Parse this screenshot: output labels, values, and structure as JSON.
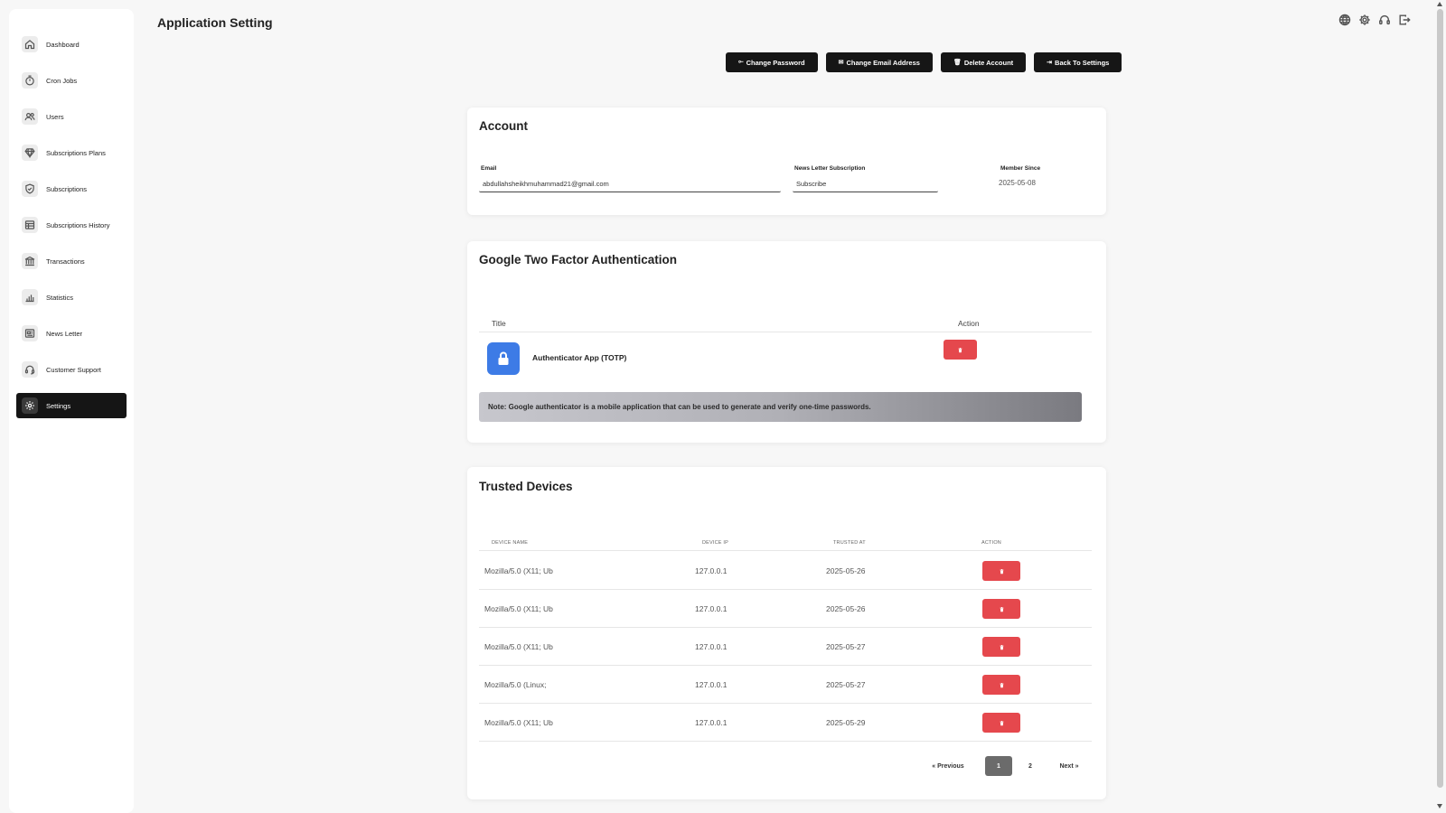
{
  "page": {
    "title": "Application Setting"
  },
  "sidebar": {
    "items": [
      {
        "label": "Dashboard",
        "icon": "home-icon",
        "active": false
      },
      {
        "label": "Cron Jobs",
        "icon": "timer-icon",
        "active": false
      },
      {
        "label": "Users",
        "icon": "users-icon",
        "active": false
      },
      {
        "label": "Subscriptions Plans",
        "icon": "diamond-icon",
        "active": false
      },
      {
        "label": "Subscriptions",
        "icon": "shield-icon",
        "active": false
      },
      {
        "label": "Subscriptions History",
        "icon": "table-icon",
        "active": false
      },
      {
        "label": "Transactions",
        "icon": "bank-icon",
        "active": false
      },
      {
        "label": "Statistics",
        "icon": "bar-chart-icon",
        "active": false
      },
      {
        "label": "News Letter",
        "icon": "newspaper-icon",
        "active": false
      },
      {
        "label": "Customer Support",
        "icon": "headset-icon",
        "active": false
      },
      {
        "label": "Settings",
        "icon": "gear-icon",
        "active": true
      }
    ]
  },
  "topbar": {
    "icons": [
      "globe-icon",
      "gear-icon",
      "headset-icon",
      "logout-icon"
    ]
  },
  "actions": {
    "change_password": "Change Password",
    "change_password_icon": "⟜",
    "change_email": "Change Email Address",
    "change_email_icon": "✉",
    "delete_account": "Delete Account",
    "delete_account_icon": "🗑",
    "back_to_settings": "Back To Settings",
    "back_to_settings_icon": "⇥"
  },
  "account": {
    "title": "Account",
    "email_label": "Email",
    "email_value": "abdullahsheikhmuhammad21@gmail.com",
    "newsletter_label": "News Letter Subscription",
    "newsletter_value": "Subscribe",
    "member_since_label": "Member Since",
    "member_since_value": "2025-05-08"
  },
  "two_factor": {
    "title": "Google Two Factor Authentication",
    "col_title": "Title",
    "col_action": "Action",
    "row_title": "Authenticator App (TOTP)",
    "note": "Note: Google authenticator is a mobile application that can be used to generate and verify one-time passwords.",
    "accent": "#3d7be6"
  },
  "trusted": {
    "title": "Trusted Devices",
    "columns": [
      "DEVICE NAME",
      "DEVICE IP",
      "TRUSTED AT",
      "ACTION"
    ],
    "rows": [
      {
        "device": "Mozilla/5.0 (X11; Ub",
        "ip": "127.0.0.1",
        "trusted_at": "2025-05-26"
      },
      {
        "device": "Mozilla/5.0 (X11; Ub",
        "ip": "127.0.0.1",
        "trusted_at": "2025-05-26"
      },
      {
        "device": "Mozilla/5.0 (X11; Ub",
        "ip": "127.0.0.1",
        "trusted_at": "2025-05-27"
      },
      {
        "device": "Mozilla/5.0 (Linux;",
        "ip": "127.0.0.1",
        "trusted_at": "2025-05-27"
      },
      {
        "device": "Mozilla/5.0 (X11; Ub",
        "ip": "127.0.0.1",
        "trusted_at": "2025-05-29"
      }
    ],
    "pagination": {
      "previous": "« Previous",
      "pages": [
        "1",
        "2"
      ],
      "current_page": "1",
      "next": "Next »"
    },
    "delete_color": "#e5484d"
  }
}
